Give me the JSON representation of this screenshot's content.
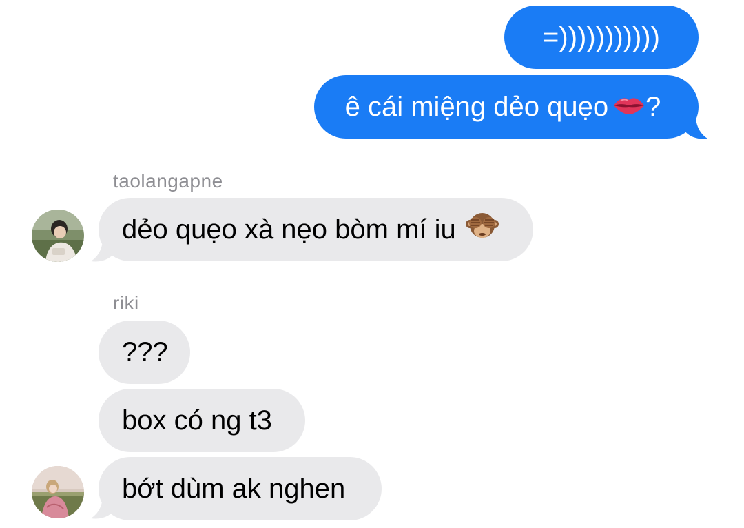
{
  "messages": {
    "outgoing": [
      {
        "text": "=)))))))))))"
      },
      {
        "text": "ê cái miệng dẻo quẹo",
        "suffix": "?",
        "emoji": "lips"
      }
    ],
    "group1": {
      "sender": "taolangapne",
      "messages": [
        {
          "text": "dẻo quẹo xà nẹo bòm mí iu",
          "emoji": "see-no-evil-monkey"
        }
      ]
    },
    "group2": {
      "sender": "riki",
      "messages": [
        {
          "text": "???"
        },
        {
          "text": "box có ng t3"
        },
        {
          "text": "bớt dùm ak nghen"
        }
      ]
    }
  },
  "colors": {
    "outgoing_bubble": "#1a7cf5",
    "incoming_bubble": "#e9e9eb",
    "sender_label": "#8e8e93"
  }
}
